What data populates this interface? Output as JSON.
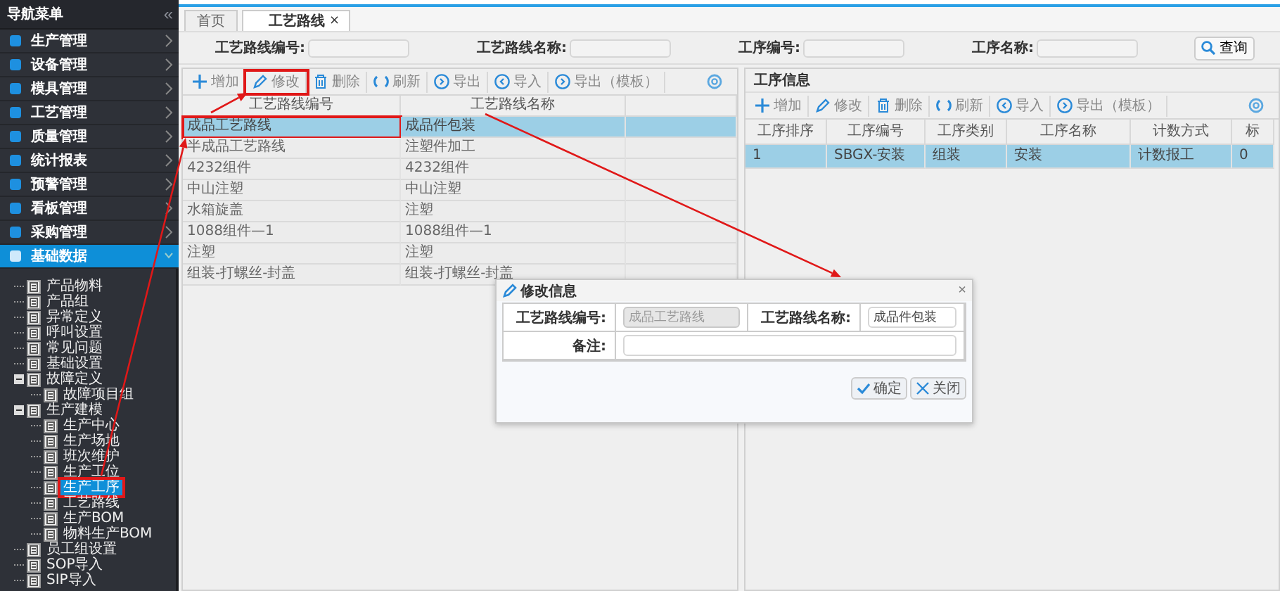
{
  "sidebar": {
    "title": "导航菜单",
    "collapse": "«",
    "menu": [
      {
        "label": "生产管理",
        "selected": false
      },
      {
        "label": "设备管理",
        "selected": false
      },
      {
        "label": "模具管理",
        "selected": false
      },
      {
        "label": "工艺管理",
        "selected": false
      },
      {
        "label": "质量管理",
        "selected": false
      },
      {
        "label": "统计报表",
        "selected": false
      },
      {
        "label": "预警管理",
        "selected": false
      },
      {
        "label": "看板管理",
        "selected": false
      },
      {
        "label": "采购管理",
        "selected": false
      },
      {
        "label": "基础数据",
        "selected": true
      }
    ],
    "tree": [
      {
        "label": "产品物料",
        "selected": false,
        "annotated": false
      },
      {
        "label": "产品组",
        "selected": false,
        "annotated": false
      },
      {
        "label": "异常定义",
        "selected": false,
        "annotated": false
      },
      {
        "label": "呼叫设置",
        "selected": false,
        "annotated": false
      },
      {
        "label": "常见问题",
        "selected": false,
        "annotated": false
      },
      {
        "label": "基础设置",
        "selected": false,
        "annotated": false
      },
      {
        "label": "故障定义",
        "selected": false,
        "annotated": false,
        "expanded": true,
        "children": [
          {
            "label": "故障项目组",
            "selected": false,
            "annotated": false
          }
        ]
      },
      {
        "label": "生产建模",
        "selected": false,
        "annotated": false,
        "expanded": true,
        "children": [
          {
            "label": "生产中心",
            "selected": false,
            "annotated": false
          },
          {
            "label": "生产场地",
            "selected": false,
            "annotated": false
          },
          {
            "label": "班次维护",
            "selected": false,
            "annotated": false
          },
          {
            "label": "生产工位",
            "selected": false,
            "annotated": false
          },
          {
            "label": "生产工序",
            "selected": true,
            "annotated": true
          },
          {
            "label": "工艺路线",
            "selected": false,
            "annotated": false
          },
          {
            "label": "生产BOM",
            "selected": false,
            "annotated": false
          },
          {
            "label": "物料生产BOM",
            "selected": false,
            "annotated": false
          }
        ]
      },
      {
        "label": "员工组设置",
        "selected": false,
        "annotated": false
      },
      {
        "label": "SOP导入",
        "selected": false,
        "annotated": false
      },
      {
        "label": "SIP导入",
        "selected": false,
        "annotated": false
      }
    ]
  },
  "tabs": [
    {
      "label": "首页",
      "selected": false
    },
    {
      "label": "工艺路线",
      "selected": true,
      "close": "×"
    }
  ],
  "search": {
    "fields": [
      {
        "label": "工艺路线编号:"
      },
      {
        "label": "工艺路线名称:"
      },
      {
        "label": "工序编号:"
      },
      {
        "label": "工序名称:"
      }
    ],
    "button": "查询"
  },
  "route_table": {
    "toolbar": [
      {
        "kind": "add",
        "label": "增加",
        "annotated": false
      },
      {
        "kind": "edit",
        "label": "修改",
        "annotated": true
      },
      {
        "kind": "delete",
        "label": "删除",
        "annotated": false
      },
      {
        "kind": "refresh",
        "label": "刷新",
        "annotated": false
      },
      {
        "kind": "export",
        "label": "导出",
        "annotated": false
      },
      {
        "kind": "import",
        "label": "导入",
        "annotated": false
      },
      {
        "kind": "export",
        "label": "导出（模板）",
        "annotated": false
      }
    ],
    "columns": [
      "工艺路线编号",
      "工艺路线名称"
    ],
    "rows": [
      {
        "cells": [
          "成品工艺路线",
          "成品件包装"
        ],
        "selected": true,
        "annotated": true
      },
      {
        "cells": [
          "半成品工艺路线",
          "注塑件加工"
        ],
        "selected": false,
        "annotated": false
      },
      {
        "cells": [
          "4232组件",
          "4232组件"
        ],
        "selected": false,
        "annotated": false
      },
      {
        "cells": [
          "中山注塑",
          "中山注塑"
        ],
        "selected": false,
        "annotated": false
      },
      {
        "cells": [
          "水箱旋盖",
          "注塑"
        ],
        "selected": false,
        "annotated": false
      },
      {
        "cells": [
          "1088组件—1",
          "1088组件—1"
        ],
        "selected": false,
        "annotated": false
      },
      {
        "cells": [
          "注塑",
          "注塑"
        ],
        "selected": false,
        "annotated": false
      },
      {
        "cells": [
          "组装-打螺丝-封盖",
          "组装-打螺丝-封盖"
        ],
        "selected": false,
        "annotated": false
      }
    ]
  },
  "process_panel": {
    "title": "工序信息",
    "toolbar": [
      {
        "kind": "add",
        "label": "增加",
        "annotated": false
      },
      {
        "kind": "edit",
        "label": "修改",
        "annotated": false
      },
      {
        "kind": "delete",
        "label": "删除",
        "annotated": false
      },
      {
        "kind": "refresh",
        "label": "刷新",
        "annotated": false
      },
      {
        "kind": "import",
        "label": "导入",
        "annotated": false
      },
      {
        "kind": "export",
        "label": "导出（模板）",
        "annotated": false
      }
    ],
    "columns": [
      "工序排序",
      "工序编号",
      "工序类别",
      "工序名称",
      "计数方式",
      "标"
    ],
    "rows": [
      {
        "cells": [
          "1",
          "SBGX-安装",
          "组装",
          "安装",
          "计数报工",
          "0"
        ],
        "selected": true
      }
    ]
  },
  "dialog": {
    "title": "修改信息",
    "close": "×",
    "fields": [
      {
        "label": "工艺路线编号:",
        "value": "成品工艺路线",
        "disabled": true
      },
      {
        "label": "工艺路线名称:",
        "value": "成品件包装",
        "disabled": false
      },
      {
        "label": "备注:",
        "disabled": false
      }
    ],
    "buttons": [
      {
        "kind": "ok",
        "label": "确定"
      },
      {
        "kind": "close",
        "label": "关闭"
      }
    ]
  }
}
